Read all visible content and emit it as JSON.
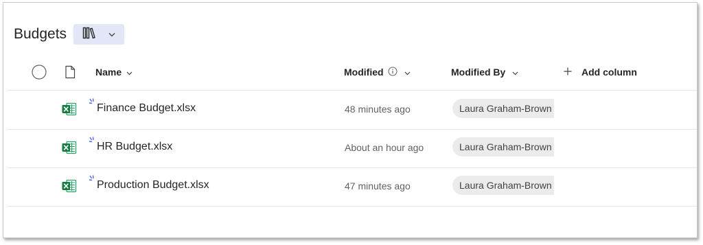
{
  "library": {
    "title": "Budgets",
    "view_icon": "library-icon",
    "view_chevron": "chevron-down-icon"
  },
  "columns": {
    "name": "Name",
    "modified": "Modified",
    "modified_by": "Modified By",
    "add_column": "Add column"
  },
  "files": [
    {
      "name": "Finance Budget.xlsx",
      "modified": "48 minutes ago",
      "modified_by": "Laura Graham-Brown",
      "icon": "excel-file-icon"
    },
    {
      "name": "HR Budget.xlsx",
      "modified": "About an hour ago",
      "modified_by": "Laura Graham-Brown",
      "icon": "excel-file-icon"
    },
    {
      "name": "Production Budget.xlsx",
      "modified": "47 minutes ago",
      "modified_by": "Laura Graham-Brown",
      "icon": "excel-file-icon"
    }
  ],
  "colors": {
    "excel_green": "#107c41",
    "new_marker": "#4f6bed",
    "view_button_bg": "#e3e6f7",
    "pill_bg": "#ebebeb"
  }
}
